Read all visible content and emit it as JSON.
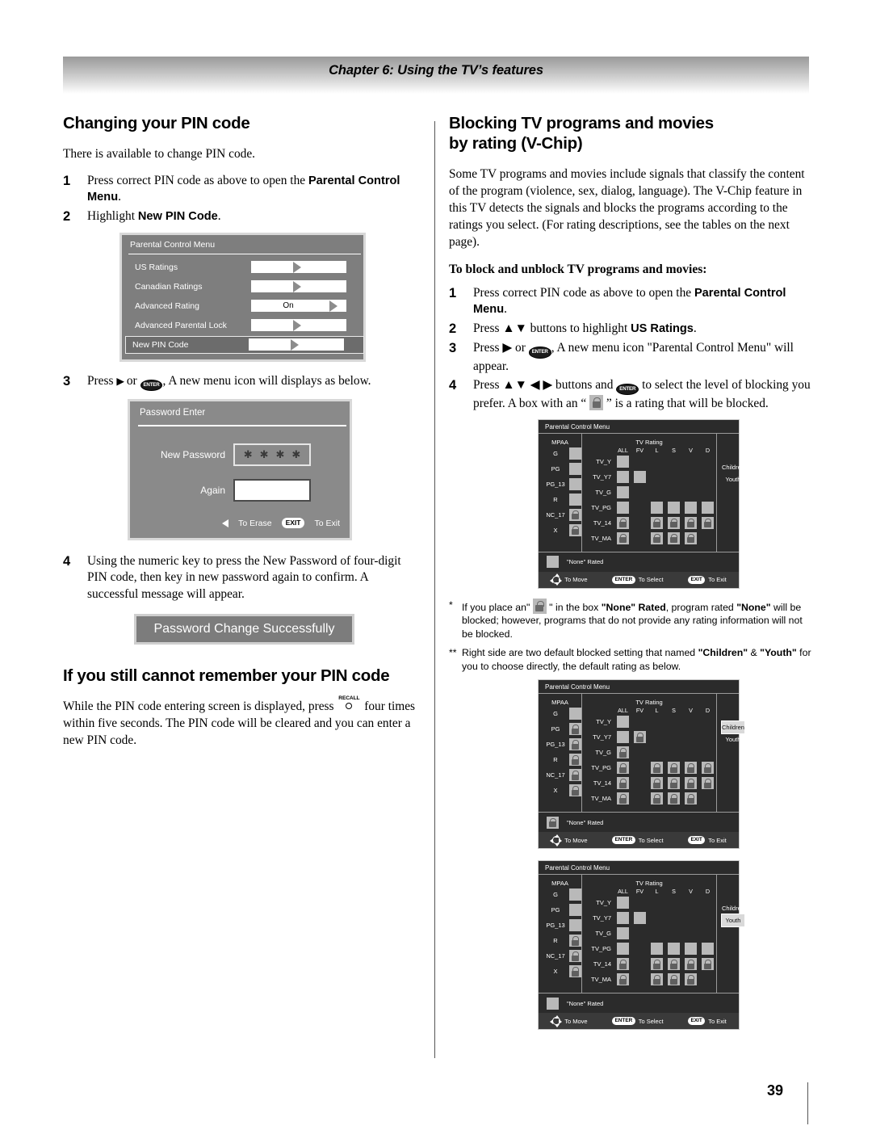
{
  "header": {
    "chapter_title": "Chapter 6: Using the TV’s features"
  },
  "page_number": "39",
  "left": {
    "section_title": "Changing your PIN code",
    "intro": "There is available to change PIN code.",
    "steps": [
      {
        "num": "1",
        "pre": "Press correct PIN code as above to open the ",
        "bold": "Parental Control Menu",
        "post": "."
      },
      {
        "num": "2",
        "pre": "Highlight ",
        "bold": "New PIN Code",
        "post": "."
      },
      {
        "num": "3",
        "pre": "Press ",
        "post": ", A new menu icon will displays as below."
      },
      {
        "num": "4",
        "text": "Using the numeric key to press the New Password of four-digit PIN code, then key in new password again to confirm. A successful message will appear."
      }
    ],
    "osd_menu": {
      "title": "Parental Control Menu",
      "rows": [
        {
          "label": "US Ratings",
          "value": "",
          "selected": false
        },
        {
          "label": "Canadian Ratings",
          "value": "",
          "selected": false
        },
        {
          "label": "Advanced Rating",
          "value": "On",
          "selected": false
        },
        {
          "label": "Advanced Parental Lock",
          "value": "",
          "selected": false
        },
        {
          "label": "New PIN Code",
          "value": "",
          "selected": true
        }
      ]
    },
    "osd_password": {
      "title": "Password Enter",
      "new_password_label": "New Password",
      "new_password_value": "∗ ∗ ∗ ∗",
      "again_label": "Again",
      "again_value": "",
      "erase_hint": "To Erase",
      "exit_key": "EXIT",
      "exit_hint": "To Exit"
    },
    "success_banner": "Password Change Successfully",
    "section2_title": "If you still cannot remember your PIN code",
    "section2_body_pre": "While the PIN code entering screen is displayed, press ",
    "recall_key": "RECALL",
    "section2_body_post": "four times within five seconds. The PIN code will be cleared and you can enter a new PIN code."
  },
  "right": {
    "section_title_line1": "Blocking TV programs and movies",
    "section_title_line2": "by rating (V-Chip)",
    "intro": "Some TV programs and movies include signals that classify the content of the program (violence, sex, dialog, language). The V-Chip feature in this TV detects the signals and blocks the programs according to the ratings you select. (For rating descriptions, see the tables on the next page).",
    "subhead": "To block and unblock TV programs and movies:",
    "steps": [
      {
        "num": "1",
        "pre": "Press correct PIN code as above to open the ",
        "bold": "Parental Control Menu",
        "post": "."
      },
      {
        "num": "2",
        "pre": "Press ▲▼ buttons to highlight ",
        "bold": "US Ratings",
        "post": "."
      },
      {
        "num": "3",
        "pre": "Press ▶ or ",
        "post": ", A new menu icon \"Parental Control Menu\" will appear."
      },
      {
        "num": "4",
        "pre": "Press ▲▼ ◀ ▶ buttons and ",
        "mid": " to select the level of blocking you prefer. A box with an “ ",
        "post": " ” is a rating that will be blocked."
      }
    ],
    "notes": [
      {
        "marker": "*",
        "seg1": "If you place an\" ",
        "seg2": " \" in the box ",
        "b1": "\"None\" Rated",
        "seg3": ", program rated ",
        "b2": "\"None\"",
        "seg4": " will be blocked; however, programs that do not provide any rating information will not be blocked."
      },
      {
        "marker": "**",
        "seg1": "Right side are two default blocked setting that named ",
        "b1": "\"Children\"",
        "seg2": " & ",
        "b2": "\"Youth\"",
        "seg3": " for you to choose directly, the default rating as below."
      }
    ],
    "vchip_common": {
      "title": "Parental Control Menu",
      "mpaa_header": "MPAA",
      "tv_header": "TV Rating",
      "tv_columns": [
        "ALL",
        "FV",
        "L",
        "S",
        "V",
        "D"
      ],
      "mpaa_rows": [
        "G",
        "PG",
        "PG_13",
        "R",
        "NC_17",
        "X"
      ],
      "tv_rows": [
        "TV_Y",
        "TV_Y7",
        "TV_G",
        "TV_PG",
        "TV_14",
        "TV_MA"
      ],
      "side_options": [
        "Children",
        "Youth"
      ],
      "none_rated_label": "\"None\" Rated",
      "footer": {
        "move_hint": "To Move",
        "enter_key": "ENTER",
        "select_hint": "To Select",
        "exit_key": "EXIT",
        "exit_hint": "To Exit"
      }
    }
  },
  "chart_data": {
    "type": "table",
    "title": "V-Chip Parental Control rating grids",
    "tables": [
      {
        "name": "default",
        "selected_side_option": null,
        "none_rated": "box",
        "mpaa": {
          "G": "box",
          "PG": "box",
          "PG_13": "box",
          "R": "box",
          "NC_17": "lock",
          "X": "lock"
        },
        "tv": {
          "TV_Y": {
            "ALL": "box",
            "FV": "none",
            "L": "none",
            "S": "none",
            "V": "none",
            "D": "none"
          },
          "TV_Y7": {
            "ALL": "box",
            "FV": "box",
            "L": "none",
            "S": "none",
            "V": "none",
            "D": "none"
          },
          "TV_G": {
            "ALL": "box",
            "FV": "none",
            "L": "none",
            "S": "none",
            "V": "none",
            "D": "none"
          },
          "TV_PG": {
            "ALL": "box",
            "FV": "none",
            "L": "box",
            "S": "box",
            "V": "box",
            "D": "box"
          },
          "TV_14": {
            "ALL": "lock",
            "FV": "none",
            "L": "lock",
            "S": "lock",
            "V": "lock",
            "D": "lock"
          },
          "TV_MA": {
            "ALL": "lock",
            "FV": "none",
            "L": "lock",
            "S": "lock",
            "V": "lock",
            "D": "none"
          }
        }
      },
      {
        "name": "Children",
        "selected_side_option": "Children",
        "none_rated": "lock",
        "mpaa": {
          "G": "box",
          "PG": "lock",
          "PG_13": "lock",
          "R": "lock",
          "NC_17": "lock",
          "X": "lock"
        },
        "tv": {
          "TV_Y": {
            "ALL": "box",
            "FV": "none",
            "L": "none",
            "S": "none",
            "V": "none",
            "D": "none"
          },
          "TV_Y7": {
            "ALL": "box",
            "FV": "lock",
            "L": "none",
            "S": "none",
            "V": "none",
            "D": "none"
          },
          "TV_G": {
            "ALL": "lock",
            "FV": "none",
            "L": "none",
            "S": "none",
            "V": "none",
            "D": "none"
          },
          "TV_PG": {
            "ALL": "lock",
            "FV": "none",
            "L": "lock",
            "S": "lock",
            "V": "lock",
            "D": "lock"
          },
          "TV_14": {
            "ALL": "lock",
            "FV": "none",
            "L": "lock",
            "S": "lock",
            "V": "lock",
            "D": "lock"
          },
          "TV_MA": {
            "ALL": "lock",
            "FV": "none",
            "L": "lock",
            "S": "lock",
            "V": "lock",
            "D": "none"
          }
        }
      },
      {
        "name": "Youth",
        "selected_side_option": "Youth",
        "none_rated": "box",
        "mpaa": {
          "G": "box",
          "PG": "box",
          "PG_13": "box",
          "R": "lock",
          "NC_17": "lock",
          "X": "lock"
        },
        "tv": {
          "TV_Y": {
            "ALL": "box",
            "FV": "none",
            "L": "none",
            "S": "none",
            "V": "none",
            "D": "none"
          },
          "TV_Y7": {
            "ALL": "box",
            "FV": "box",
            "L": "none",
            "S": "none",
            "V": "none",
            "D": "none"
          },
          "TV_G": {
            "ALL": "box",
            "FV": "none",
            "L": "none",
            "S": "none",
            "V": "none",
            "D": "none"
          },
          "TV_PG": {
            "ALL": "box",
            "FV": "none",
            "L": "box",
            "S": "box",
            "V": "box",
            "D": "box"
          },
          "TV_14": {
            "ALL": "lock",
            "FV": "none",
            "L": "lock",
            "S": "lock",
            "V": "lock",
            "D": "lock"
          },
          "TV_MA": {
            "ALL": "lock",
            "FV": "none",
            "L": "lock",
            "S": "lock",
            "V": "lock",
            "D": "none"
          }
        }
      }
    ]
  }
}
